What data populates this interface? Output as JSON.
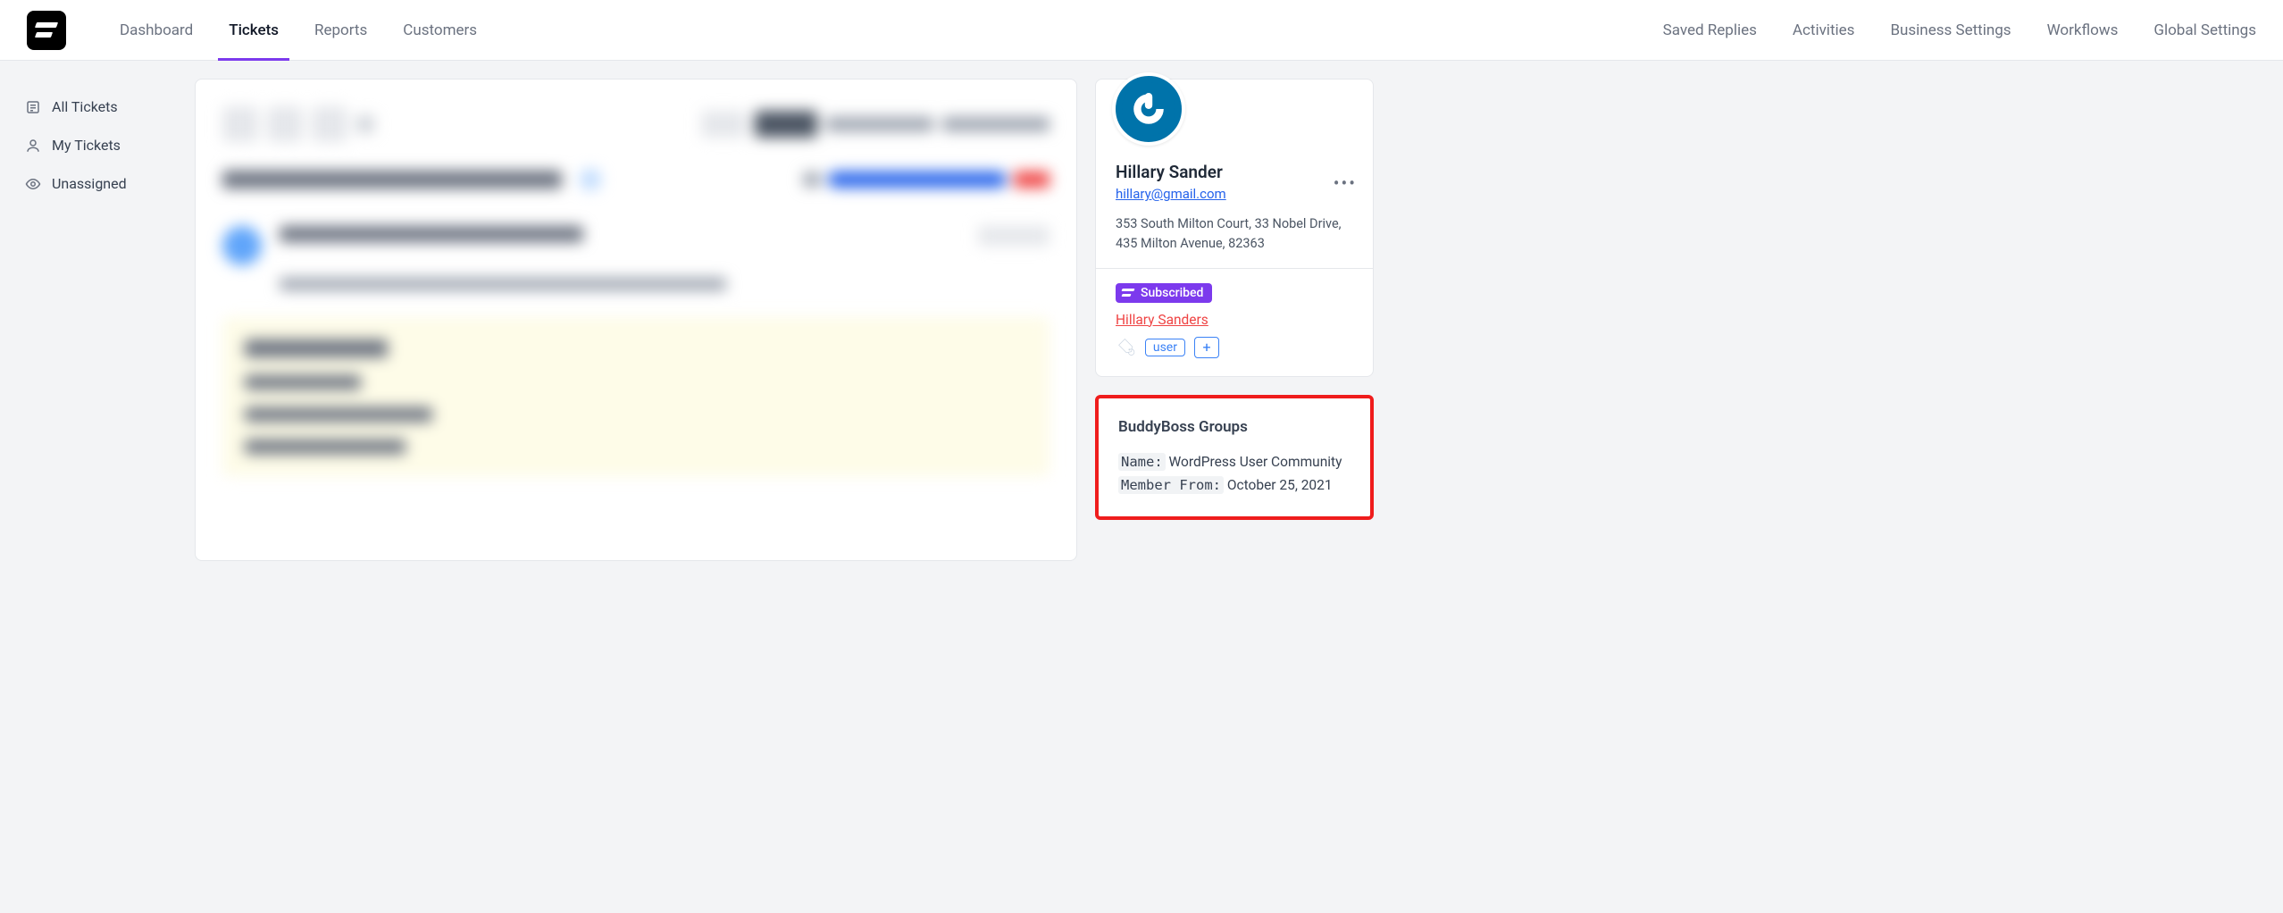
{
  "nav": {
    "left": [
      {
        "label": "Dashboard",
        "active": false
      },
      {
        "label": "Tickets",
        "active": true
      },
      {
        "label": "Reports",
        "active": false
      },
      {
        "label": "Customers",
        "active": false
      }
    ],
    "right": [
      {
        "label": "Saved Replies"
      },
      {
        "label": "Activities"
      },
      {
        "label": "Business Settings"
      },
      {
        "label": "Workflows"
      },
      {
        "label": "Global Settings"
      }
    ]
  },
  "sidebar": {
    "items": [
      {
        "label": "All Tickets",
        "icon": "list"
      },
      {
        "label": "My Tickets",
        "icon": "user"
      },
      {
        "label": "Unassigned",
        "icon": "eye"
      }
    ]
  },
  "customer": {
    "name": "Hillary Sander",
    "email": "hillary@gmail.com",
    "address": "353 South Milton Court, 33 Nobel Drive, 435 Milton Avenue, 82363",
    "badge": "Subscribed",
    "name_link": "Hillary Sanders",
    "tag": "user"
  },
  "groups": {
    "title": "BuddyBoss Groups",
    "name_label": "Name:",
    "name_value": "WordPress User Community",
    "since_label": "Member From:",
    "since_value": "October 25, 2021"
  }
}
